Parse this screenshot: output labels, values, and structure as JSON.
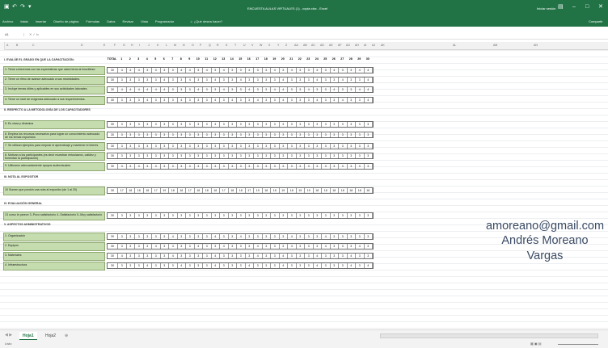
{
  "window": {
    "title": "ENCUESTA AULAS VIRTUALES (1) - copia.xlsx - Excel",
    "user": "Iniciar sesión"
  },
  "ribbon_tabs": [
    "Archivo",
    "Inicio",
    "Insertar",
    "Diseño de página",
    "Fórmulas",
    "Datos",
    "Revisar",
    "Vista",
    "Programador"
  ],
  "tell_me": "¿Qué desea hacer?",
  "share": "Compartir",
  "name_box": "A1",
  "formula_value": "",
  "columns": [
    "A",
    "B",
    "C",
    "D",
    "E",
    "F",
    "G",
    "H",
    "I",
    "J",
    "K",
    "L",
    "M",
    "N",
    "O",
    "P",
    "Q",
    "R",
    "S",
    "T",
    "U",
    "V",
    "W",
    "X",
    "Y",
    "Z",
    "AA",
    "AB",
    "AC",
    "AD",
    "AE",
    "AF",
    "AG",
    "AH",
    "AI",
    "AJ",
    "AK",
    "AL",
    "AM",
    "AN"
  ],
  "header": {
    "label": "I. EVALÚE EL GRADO EN QUE LA CAPACITACIÓN:",
    "total": "TOTAL",
    "nums": [
      "1",
      "2",
      "3",
      "4",
      "5",
      "6",
      "7",
      "8",
      "9",
      "10",
      "11",
      "12",
      "13",
      "14",
      "15",
      "16",
      "17",
      "18",
      "19",
      "20",
      "21",
      "22",
      "23",
      "24",
      "25",
      "26",
      "27",
      "28",
      "29",
      "30"
    ]
  },
  "sections": [
    {
      "title": "",
      "rows": [
        {
          "label": "1. Tiene coherencia con las expectativas que usted tenía al inscribirse.",
          "total": "30",
          "values": [
            "4",
            "4",
            "4",
            "3",
            "3",
            "3",
            "3",
            "4",
            "4",
            "3",
            "4",
            "3",
            "4",
            "3",
            "3",
            "4",
            "3",
            "3",
            "4",
            "3",
            "4",
            "3",
            "3",
            "4",
            "3",
            "4",
            "3",
            "3",
            "4",
            "4"
          ]
        },
        {
          "label": "2. Tiene un ritmo de avance adecuado a sus necesidades.",
          "total": "30",
          "values": [
            "3",
            "3",
            "3",
            "3",
            "3",
            "4",
            "3",
            "3",
            "4",
            "3",
            "3",
            "4",
            "3",
            "3",
            "4",
            "3",
            "3",
            "3",
            "3",
            "4",
            "3",
            "3",
            "3",
            "4",
            "3",
            "3",
            "4",
            "3",
            "3",
            "4"
          ]
        },
        {
          "label": "3. Incluye temas útiles y aplicables en sus actividades laborales.",
          "total": "30",
          "values": [
            "4",
            "4",
            "4",
            "4",
            "4",
            "4",
            "3",
            "3",
            "3",
            "4",
            "3",
            "3",
            "4",
            "3",
            "3",
            "4",
            "3",
            "3",
            "4",
            "4",
            "3",
            "3",
            "4",
            "3",
            "3",
            "4",
            "3",
            "3",
            "4",
            "4"
          ]
        },
        {
          "label": "4. Tiene un nivel de exigencia adecuado a sus requerimientos.",
          "total": "30",
          "values": [
            "3",
            "3",
            "3",
            "4",
            "3",
            "3",
            "3",
            "4",
            "3",
            "3",
            "3",
            "4",
            "3",
            "4",
            "3",
            "3",
            "4",
            "3",
            "3",
            "4",
            "3",
            "3",
            "3",
            "4",
            "3",
            "3",
            "4",
            "3",
            "3",
            "4"
          ]
        }
      ]
    },
    {
      "title": "II. RESPECTO A LA METODOLOGÍA DE LOS CAPACITADORES",
      "rows": [
        {
          "label": "5. Es clara y dinámica",
          "total": "30",
          "values": [
            "3",
            "3",
            "3",
            "3",
            "3",
            "3",
            "3",
            "3",
            "3",
            "3",
            "3",
            "3",
            "3",
            "3",
            "3",
            "3",
            "3",
            "3",
            "3",
            "3",
            "3",
            "3",
            "3",
            "3",
            "3",
            "3",
            "3",
            "3",
            "3",
            "3"
          ]
        },
        {
          "label": "6. Emplea los recursos necesarios para lograr un conocimiento adecuado de los temas expuestos",
          "total": "30",
          "values": [
            "3",
            "3",
            "3",
            "3",
            "3",
            "3",
            "3",
            "3",
            "3",
            "3",
            "3",
            "3",
            "3",
            "3",
            "3",
            "3",
            "3",
            "3",
            "3",
            "3",
            "3",
            "3",
            "3",
            "3",
            "3",
            "3",
            "3",
            "3",
            "3",
            "3"
          ]
        },
        {
          "label": "7. Se utilizan ejemplos para mejorar el aprendizaje y mantener el interés",
          "total": "30",
          "values": [
            "3",
            "3",
            "3",
            "3",
            "3",
            "3",
            "3",
            "3",
            "3",
            "3",
            "3",
            "3",
            "3",
            "3",
            "3",
            "3",
            "3",
            "3",
            "3",
            "3",
            "3",
            "3",
            "3",
            "3",
            "3",
            "3",
            "3",
            "3",
            "3",
            "3"
          ]
        },
        {
          "label": "8. Motivan a los participantes (es decir muestran entusiasmo, calidez y fomentan la participación)",
          "total": "30",
          "values": [
            "3",
            "3",
            "3",
            "3",
            "3",
            "3",
            "3",
            "3",
            "3",
            "3",
            "3",
            "3",
            "3",
            "3",
            "3",
            "3",
            "3",
            "3",
            "3",
            "3",
            "3",
            "3",
            "3",
            "3",
            "3",
            "3",
            "3",
            "3",
            "3",
            "3"
          ]
        },
        {
          "label": "9. Utilizaron adecuadamente apoyos audiovisuales",
          "total": "30",
          "values": [
            "3",
            "3",
            "3",
            "3",
            "3",
            "3",
            "3",
            "3",
            "3",
            "3",
            "3",
            "3",
            "3",
            "3",
            "3",
            "3",
            "3",
            "3",
            "3",
            "3",
            "3",
            "3",
            "3",
            "3",
            "3",
            "3",
            "3",
            "3",
            "3",
            "3"
          ]
        }
      ]
    },
    {
      "title": "III. NOTA AL EXPOSITOR",
      "rows": [
        {
          "label": "10 Sumen que pondrá una nota al expositor (de 1 al 20)",
          "total": "30",
          "values": [
            "17",
            "18",
            "18",
            "18",
            "17",
            "19",
            "18",
            "18",
            "17",
            "18",
            "18",
            "18",
            "17",
            "18",
            "18",
            "17",
            "19",
            "18",
            "18",
            "19",
            "18",
            "19",
            "19",
            "18",
            "18",
            "18",
            "18",
            "18",
            "18",
            "18"
          ]
        }
      ]
    },
    {
      "title": "IV. EVALUACIÓN GENERAL",
      "rows": [
        {
          "label": "13 curso le parece 3.-Poco satisfactorio 4.-Satisfactorio 5.-Muy satisfactorio",
          "total": "30",
          "values": [
            "3",
            "3",
            "3",
            "3",
            "3",
            "3",
            "3",
            "3",
            "3",
            "3",
            "3",
            "3",
            "3",
            "3",
            "3",
            "3",
            "3",
            "3",
            "3",
            "3",
            "3",
            "3",
            "3",
            "3",
            "3",
            "3",
            "3",
            "3",
            "3",
            "3"
          ]
        }
      ]
    },
    {
      "title": "V. ASPECTOS ADMINISTRATIVOS",
      "rows": [
        {
          "label": "1. Organización",
          "total": "30",
          "values": [
            "3",
            "3",
            "3",
            "3",
            "3",
            "3",
            "4",
            "3",
            "3",
            "3",
            "3",
            "4",
            "3",
            "3",
            "4",
            "3",
            "3",
            "3",
            "3",
            "3",
            "4",
            "3",
            "3",
            "3",
            "4",
            "3",
            "3",
            "3",
            "3",
            "3"
          ]
        },
        {
          "label": "2. Equipos",
          "total": "30",
          "values": [
            "3",
            "3",
            "3",
            "3",
            "4",
            "3",
            "4",
            "3",
            "3",
            "4",
            "3",
            "3",
            "4",
            "3",
            "3",
            "3",
            "4",
            "3",
            "3",
            "3",
            "4",
            "3",
            "3",
            "3",
            "4",
            "3",
            "3",
            "3",
            "4",
            "3"
          ]
        },
        {
          "label": "3. Materiales",
          "total": "30",
          "values": [
            "4",
            "3",
            "3",
            "3",
            "3",
            "3",
            "4",
            "3",
            "3",
            "3",
            "3",
            "4",
            "3",
            "3",
            "3",
            "3",
            "4",
            "3",
            "3",
            "4",
            "3",
            "3",
            "3",
            "4",
            "3",
            "3",
            "3",
            "4",
            "3",
            "3"
          ]
        },
        {
          "label": "4. Infraestructura",
          "total": "30",
          "values": [
            "3",
            "3",
            "3",
            "4",
            "3",
            "3",
            "3",
            "4",
            "3",
            "3",
            "3",
            "4",
            "3",
            "3",
            "3",
            "4",
            "3",
            "3",
            "3",
            "4",
            "3",
            "3",
            "3",
            "4",
            "3",
            "3",
            "3",
            "4",
            "3",
            "4"
          ]
        }
      ]
    }
  ],
  "contact": {
    "email": "amoreano@gmail.com",
    "name_line1": "Andrés Moreano",
    "name_line2": "Vargas"
  },
  "sheet_tabs": [
    "Hoja1",
    "Hoja2"
  ],
  "active_tab": "Hoja1",
  "status": "Listo"
}
